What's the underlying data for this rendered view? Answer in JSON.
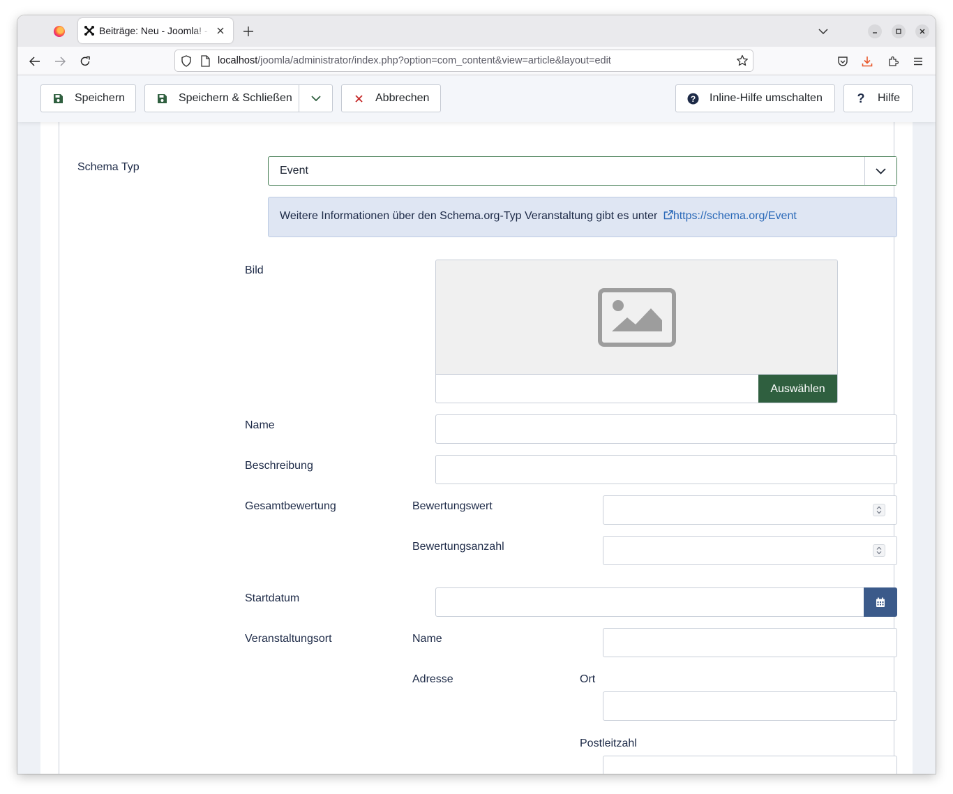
{
  "browser": {
    "tab_title": "Beiträge: Neu - Joomla! - Administration",
    "url_host": "localhost",
    "url_path": "/joomla/administrator/index.php?option=com_content&view=article&layout=edit"
  },
  "toolbar": {
    "save_label": "Speichern",
    "save_close_label": "Speichern & Schließen",
    "cancel_label": "Abbrechen",
    "inline_help_label": "Inline-Hilfe umschalten",
    "help_label": "Hilfe"
  },
  "form": {
    "schema_type_label": "Schema Typ",
    "schema_type_value": "Event",
    "info_text": "Weitere Informationen über den Schema.org-Typ Veranstaltung gibt es unter",
    "info_link": "https://schema.org/Event",
    "image_label": "Bild",
    "select_button": "Auswählen",
    "name_label": "Name",
    "description_label": "Beschreibung",
    "aggregate_rating_label": "Gesamtbewertung",
    "rating_value_label": "Bewertungswert",
    "rating_count_label": "Bewertungsanzahl",
    "start_date_label": "Startdatum",
    "location_label": "Veranstaltungsort",
    "location_name_label": "Name",
    "address_label": "Adresse",
    "city_label": "Ort",
    "postal_code_label": "Postleitzahl"
  },
  "colors": {
    "primary_green": "#2f5f3f",
    "calendar_blue": "#3b5a8a",
    "link_blue": "#2a69b8",
    "alert_bg": "#dfe6f3"
  }
}
